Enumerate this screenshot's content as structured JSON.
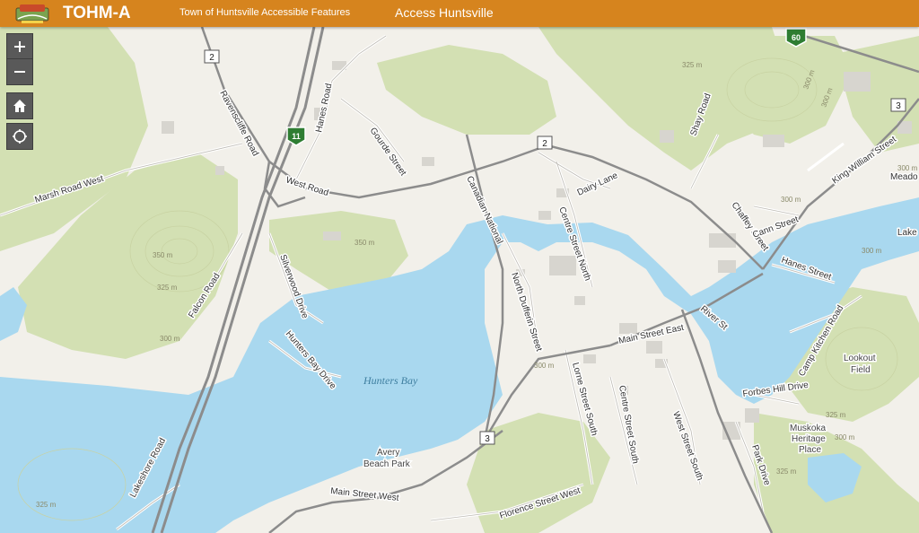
{
  "header": {
    "app_title": "TOHM-A",
    "nav_links": [
      "Town of Huntsville Accessible Features",
      "Access Huntsville"
    ]
  },
  "controls": {
    "zoom_in": "+",
    "zoom_out": "−"
  },
  "map": {
    "water_bodies": [
      "Hunters Bay"
    ],
    "places": [
      "Avery Beach Park",
      "Lookout Field",
      "Muskoka Heritage Place"
    ],
    "highway_shields": [
      "2",
      "11",
      "2",
      "60",
      "3",
      "3"
    ],
    "roads": [
      "Marsh Road West",
      "Ravenscliffe Road",
      "West Road",
      "Hanes Road",
      "Gourde Street",
      "Canadian National",
      "Dairy Lane",
      "Centre Street North",
      "Shay Road",
      "King William Street",
      "Chaffey Street",
      "Cann Street",
      "Hanes Street",
      "Silverwood Drive",
      "Hunters Bay Drive",
      "Falcon Road",
      "North Dufferin Street",
      "Main Street East",
      "River St",
      "Lorne Street South",
      "Centre Street South",
      "West Street South",
      "Forbes Hill Drive",
      "Camp Kitchen Road",
      "Park Drive",
      "Main Street West",
      "Florence Street West",
      "Lakeshore Road",
      "Meado",
      "Lake"
    ],
    "contours": [
      "325 m",
      "300 m",
      "350 m",
      "325 m",
      "300 m",
      "325 m",
      "300 m",
      "300 m",
      "300 m",
      "325 m",
      "325 m",
      "300 m",
      "325 m",
      "300 m",
      "300 m"
    ],
    "colors": {
      "water": "#a9d8ef",
      "land": "#f2f0ea",
      "forest": "#d3e0b3",
      "road": "#8c8c8c",
      "header": "#d6841e"
    }
  }
}
